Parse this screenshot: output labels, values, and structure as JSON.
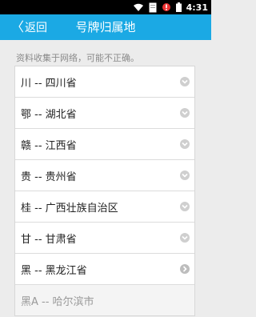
{
  "status_bar": {
    "time": "4:31"
  },
  "header": {
    "back_label": "返回",
    "title": "号牌归属地"
  },
  "notice": "资料收集于网络，可能不正确。",
  "list": [
    {
      "label": "川 -- 四川省",
      "arrow": "chevron-down"
    },
    {
      "label": "鄂 -- 湖北省",
      "arrow": "chevron-down"
    },
    {
      "label": "赣 -- 江西省",
      "arrow": "chevron-down"
    },
    {
      "label": "贵 -- 贵州省",
      "arrow": "chevron-down"
    },
    {
      "label": "桂 -- 广西壮族自治区",
      "arrow": "chevron-down"
    },
    {
      "label": "甘 -- 甘肃省",
      "arrow": "chevron-down"
    },
    {
      "label": "黑 -- 黑龙江省",
      "arrow": "chevron-right"
    },
    {
      "label": "黑A -- 哈尔滨市",
      "arrow": ""
    }
  ],
  "colors": {
    "accent": "#1ba9e4",
    "background": "#ececec"
  }
}
